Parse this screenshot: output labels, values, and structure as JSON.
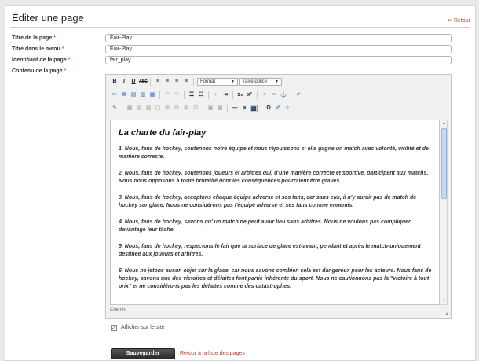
{
  "header": {
    "title": "Éditer une page",
    "back_label": "Retour",
    "back_arrow": "⇚"
  },
  "form": {
    "labels": {
      "page_title": "Titre de la page",
      "menu_title": "Titre dans le menu",
      "identifier": "Identifiant de la page",
      "content": "Contenu de la page"
    },
    "required_mark": "*",
    "values": {
      "page_title": "Fair-Play",
      "menu_title": "Fair-Play",
      "identifier": "fair_play"
    }
  },
  "editor": {
    "toolbar": {
      "format_label": "Format",
      "size_label": "Taille police"
    },
    "content_title": "La charte du fair-play",
    "paragraphs": [
      "1. Nous, fans de hockey, soutenons notre équipe et nous réjouissons si elle gagne un match avec volonté, virilité et de manière correcte.",
      "2. Nous, fans de hockey, soutenons joueurs et arbitres qui, d'une manière correcte et sportive, participent aux matchs.\nNous nous opposons à toute brutalité dont les conséquences pourraient être graves.",
      "3. Nous, fans de hockey, acceptons chaque équipe adverse et ses fans, car sans eux, il n'y aurait pas de match de hockey sur glace. Nous ne considérons pas l'équipe adverse et ses fans comme ennemis.",
      "4. Nous, fans de hockey, savons qu' un match ne peut avoir lieu sans arbitres. Nous ne voulons pas compliquer davantage leur tâche.",
      "5. Nous, fans de hockey, respectons le fait que la surface de glace est-avant, pendant et après le match-uniquement destinée aux joueurs et arbitres.",
      "6. Nous ne jetons aucun objet sur la glace, car nous savons combien cela est dangereux pour les acteurs. Nous fans de hockey, savons que des victoires et défaites font partie inhérente du sport. Nous ne cautionnons pas la \"victoire à tout prix\" et ne considérons pas les défaites comme des catastrophes."
    ],
    "path_label": "Chemin"
  },
  "options": {
    "show_on_site_label": "Afficher sur le site",
    "show_on_site_checked": true
  },
  "actions": {
    "save_label": "Sauvegarder",
    "return_list_label": "Retour à la liste des pages"
  }
}
